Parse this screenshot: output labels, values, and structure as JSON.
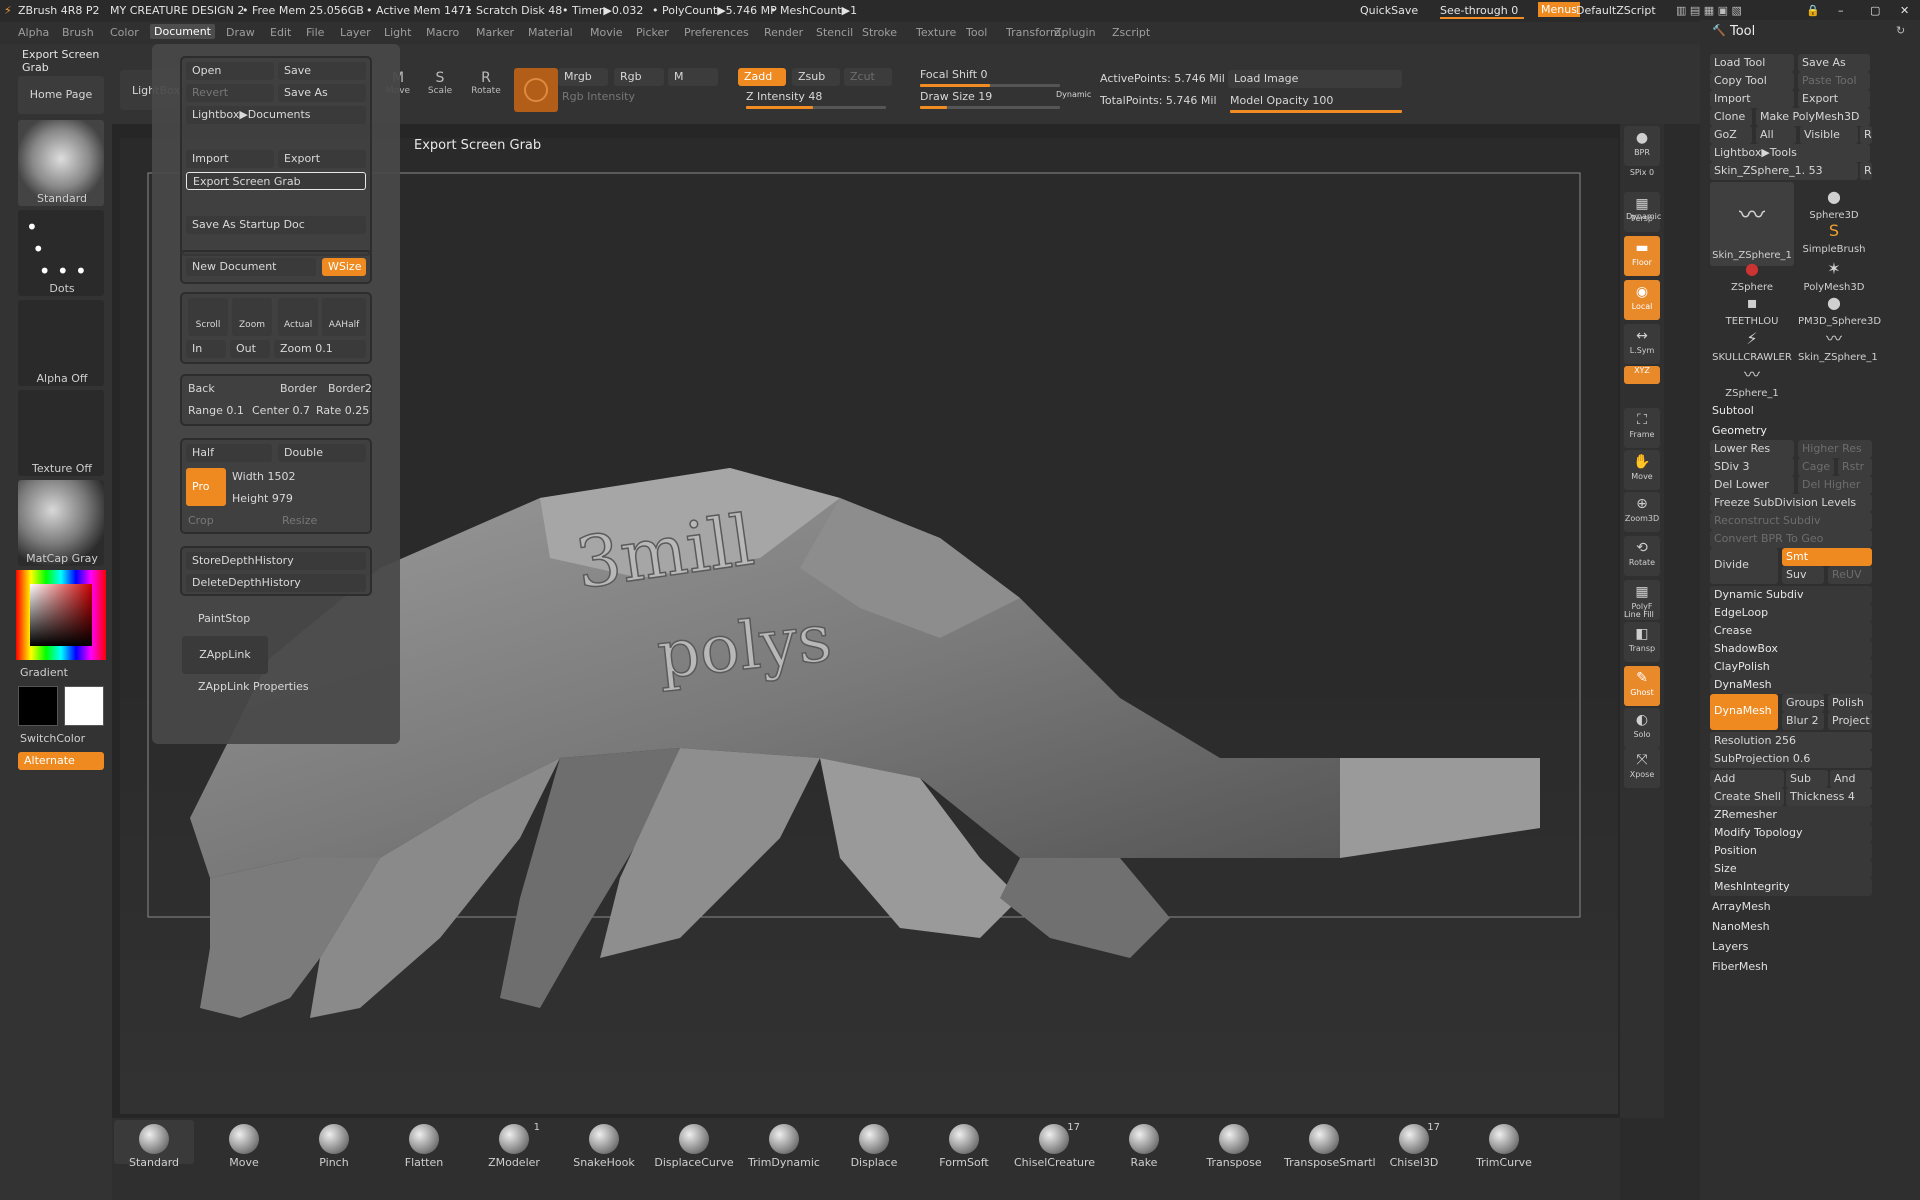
{
  "titlebar": {
    "app": "ZBrush 4R8 P2",
    "doc": "MY CREATURE DESIGN 2",
    "free_mem": "• Free Mem 25.056GB",
    "active_mem": "• Active Mem 1471",
    "scratch": "• Scratch Disk 48",
    "timer": "• Timer▶0.032",
    "polycount": "• PolyCount▶5.746 MP",
    "meshcount": "• MeshCount▶1",
    "quicksave": "QuickSave",
    "seethrough": "See-through  0",
    "menus": "Menus",
    "script": "DefaultZScript"
  },
  "menus": [
    "Alpha",
    "Brush",
    "Color",
    "Document",
    "Draw",
    "Edit",
    "File",
    "Layer",
    "Light",
    "Macro",
    "Marker",
    "Material",
    "Movie",
    "Picker",
    "Preferences",
    "Render",
    "Stencil",
    "Stroke",
    "Texture",
    "Tool",
    "Transform",
    "Zplugin",
    "Zscript"
  ],
  "active_menu": "Document",
  "left": {
    "tooltip": "Export Screen Grab",
    "home": "Home Page",
    "lightbox": "LightBox",
    "standard": "Standard",
    "dots": "Dots",
    "alpha_off": "Alpha Off",
    "texture_off": "Texture Off",
    "matcap": "MatCap Gray",
    "gradient": "Gradient",
    "switchcolor": "SwitchColor",
    "alternate": "Alternate"
  },
  "popup": {
    "open": "Open",
    "save": "Save",
    "revert": "Revert",
    "save_as": "Save As",
    "lightbox_docs": "Lightbox▶Documents",
    "import": "Import",
    "export": "Export",
    "export_grab": "Export Screen Grab",
    "startup": "Save As Startup Doc",
    "new_doc": "New Document",
    "wsize": "WSize",
    "scroll": "Scroll",
    "zoom": "Zoom",
    "actual": "Actual",
    "aahalf": "AAHalf",
    "in": "In",
    "out": "Out",
    "zoom_val": "Zoom  0.1",
    "back": "Back",
    "border": "Border",
    "border2": "Border2",
    "range": "Range  0.1",
    "center": "Center  0.7",
    "rate": "Rate  0.25",
    "half": "Half",
    "double": "Double",
    "pro": "Pro",
    "width": "Width  1502",
    "height": "Height  979",
    "crop": "Crop",
    "resize": "Resize",
    "store_depth": "StoreDepthHistory",
    "delete_depth": "DeleteDepthHistory",
    "paintstop": "PaintStop",
    "zapplink": "ZAppLink",
    "zapplink_props": "ZAppLink Properties"
  },
  "canvas_title": "Export Screen Grab",
  "topbar": {
    "move": "Move",
    "scale": "Scale",
    "rotate": "Rotate",
    "mrgb": "Mrgb",
    "rgb": "Rgb",
    "m": "M",
    "rgb_intensity": "Rgb Intensity",
    "zadd": "Zadd",
    "zsub": "Zsub",
    "zcut": "Zcut",
    "z_intensity": "Z Intensity  48",
    "focal_shift": "Focal Shift  0",
    "draw_size": "Draw Size  19",
    "dynamic": "Dynamic",
    "active_points": "ActivePoints: 5.746 Mil",
    "total_points": "TotalPoints: 5.746 Mil",
    "load_image": "Load Image",
    "model_opacity": "Model Opacity  100",
    "z_intensity_level": 0.48,
    "draw_size_level": 0.19,
    "focal_shift_level": 0.5,
    "model_opacity_level": 1.0
  },
  "shelf": [
    "BPR",
    "SPix  0",
    "Persp",
    "Floor",
    "Local",
    "L.Sym",
    "XYZ",
    "Frame",
    "Move",
    "Zoom3D",
    "Rotate",
    "PolyF",
    "Transp",
    "Ghost",
    "Solo",
    "Xpose"
  ],
  "shelf_dynamic": "Dynamic",
  "shelf_linefill": "Line Fill",
  "tool": {
    "title": "Tool",
    "load_tool": "Load Tool",
    "save_as": "Save As",
    "copy_tool": "Copy Tool",
    "paste_tool": "Paste Tool",
    "import": "Import",
    "export": "Export",
    "clone": "Clone",
    "make_polymesh": "Make PolyMesh3D",
    "goz": "GoZ",
    "all": "All",
    "visible": "Visible",
    "r": "R",
    "lightbox_tools": "Lightbox▶Tools",
    "skin_slider": "Skin_ZSphere_1.  53",
    "thumbs": [
      "Skin_ZSphere_1",
      "Sphere3D",
      "SimpleBrush",
      "ZSphere",
      "PolyMesh3D",
      "TEETHLOU",
      "PM3D_Sphere3D",
      "SKULLCRAWLER",
      "Skin_ZSphere_1",
      "ZSphere_1"
    ],
    "subtool": "Subtool",
    "geometry": "Geometry",
    "lower_res": "Lower Res",
    "higher_res": "Higher Res",
    "sdiv": "SDiv  3",
    "cage": "Cage",
    "rstr": "Rstr",
    "del_lower": "Del Lower",
    "del_higher": "Del Higher",
    "freeze": "Freeze SubDivision Levels",
    "reconstruct": "Reconstruct Subdiv",
    "convert_bpr": "Convert BPR To Geo",
    "divide": "Divide",
    "smt": "Smt",
    "suv": "Suv",
    "reuv": "ReUV",
    "sections": [
      "Dynamic Subdiv",
      "EdgeLoop",
      "Crease",
      "ShadowBox",
      "ClayPolish"
    ],
    "dynamesh_hdr": "DynaMesh",
    "dynamesh": "DynaMesh",
    "groups": "Groups",
    "polish": "Polish",
    "blur": "Blur  2",
    "project": "Project",
    "resolution": "Resolution  256",
    "subprojection": "SubProjection  0.6",
    "add": "Add",
    "sub": "Sub",
    "and": "And",
    "create_shell": "Create Shell",
    "thickness": "Thickness  4",
    "more": [
      "ZRemesher",
      "Modify Topology",
      "Position",
      "Size",
      "MeshIntegrity"
    ],
    "bottom": [
      "ArrayMesh",
      "NanoMesh",
      "Layers",
      "FiberMesh"
    ]
  },
  "brushes": [
    {
      "name": "Standard",
      "count": ""
    },
    {
      "name": "Move",
      "count": ""
    },
    {
      "name": "Pinch",
      "count": ""
    },
    {
      "name": "Flatten",
      "count": ""
    },
    {
      "name": "ZModeler",
      "count": "1"
    },
    {
      "name": "SnakeHook",
      "count": ""
    },
    {
      "name": "DisplaceCurve",
      "count": ""
    },
    {
      "name": "TrimDynamic",
      "count": ""
    },
    {
      "name": "Displace",
      "count": ""
    },
    {
      "name": "FormSoft",
      "count": ""
    },
    {
      "name": "ChiselCreature",
      "count": "17"
    },
    {
      "name": "Rake",
      "count": ""
    },
    {
      "name": "Transpose",
      "count": ""
    },
    {
      "name": "TransposeSmartl",
      "count": ""
    },
    {
      "name": "Chisel3D",
      "count": "17"
    },
    {
      "name": "TrimCurve",
      "count": ""
    }
  ]
}
